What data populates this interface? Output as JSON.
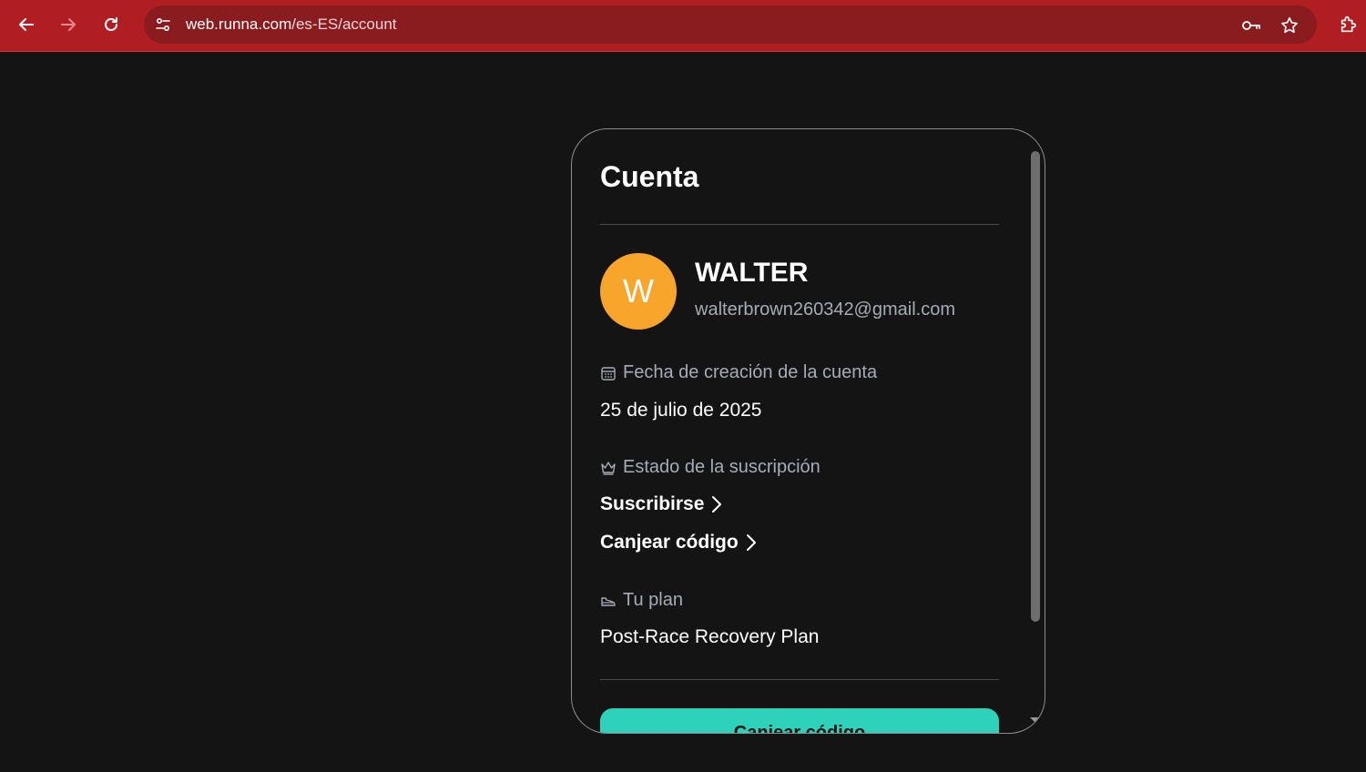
{
  "browser": {
    "url_host": "web.runna.com",
    "url_path": "/es-ES/account"
  },
  "colors": {
    "chrome_bg": "#b01e22",
    "omnibox_bg": "#8a1b1f",
    "page_bg": "#141414",
    "avatar_bg": "#f8a52b",
    "primary_button": "#2ed1b9"
  },
  "card": {
    "title": "Cuenta",
    "user": {
      "initial": "W",
      "name": "WALTER",
      "email": "walterbrown260342@gmail.com"
    },
    "creation": {
      "icon": "calendar-icon",
      "label": "Fecha de creación de la cuenta",
      "value": "25 de julio de 2025"
    },
    "subscription": {
      "icon": "crown-icon",
      "label": "Estado de la suscripción",
      "subscribe_link": "Suscribirse",
      "redeem_link": "Canjear código"
    },
    "plan": {
      "icon": "shoe-icon",
      "label": "Tu plan",
      "value": "Post-Race Recovery Plan"
    },
    "primary_button": "Canjear código"
  }
}
